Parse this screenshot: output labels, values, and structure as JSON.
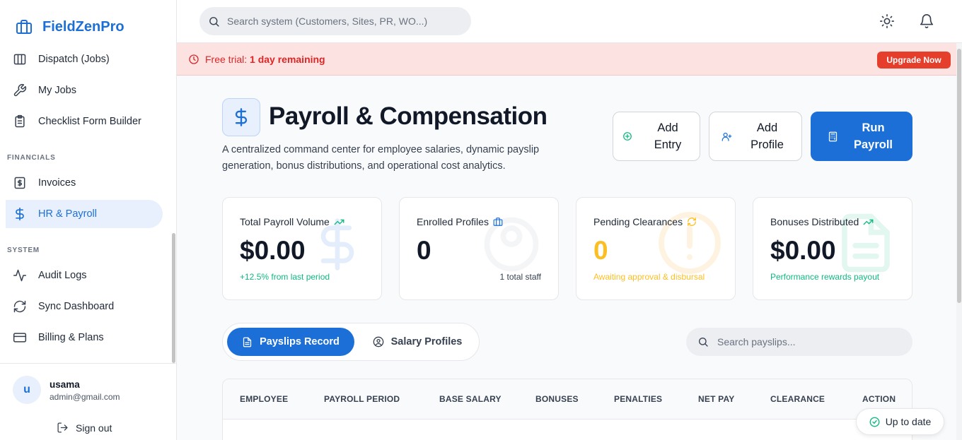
{
  "sidebar": {
    "brand": "FieldZenPro",
    "items": [
      {
        "label": "Dispatch (Jobs)",
        "icon": "columns-icon"
      },
      {
        "label": "My Jobs",
        "icon": "wrench-icon"
      },
      {
        "label": "Checklist Form Builder",
        "icon": "clipboard-icon"
      }
    ],
    "financials_label": "FINANCIALS",
    "financial_items": [
      {
        "label": "Invoices",
        "icon": "dollar-square-icon"
      },
      {
        "label": "HR & Payroll",
        "icon": "dollar-icon",
        "active": true
      }
    ],
    "system_label": "SYSTEM",
    "system_items": [
      {
        "label": "Audit Logs",
        "icon": "activity-icon"
      },
      {
        "label": "Sync Dashboard",
        "icon": "refresh-icon"
      },
      {
        "label": "Billing & Plans",
        "icon": "credit-card-icon"
      }
    ],
    "user": {
      "initial": "u",
      "name": "usama",
      "email": "admin@gmail.com"
    },
    "signout_label": "Sign out"
  },
  "topbar": {
    "search_placeholder": "Search system (Customers, Sites, PR, WO...)"
  },
  "trial": {
    "prefix": "Free trial: ",
    "remaining": "1 day remaining",
    "upgrade_label": "Upgrade Now"
  },
  "page": {
    "title": "Payroll & Compensation",
    "subtitle": "A centralized command center for employee salaries, dynamic payslip generation, bonus distributions, and operational cost analytics.",
    "buttons": {
      "add_entry": "Add Entry",
      "add_profile": "Add Profile",
      "run_payroll": "Run Payroll"
    }
  },
  "cards": [
    {
      "title": "Total Payroll Volume",
      "value": "$0.00",
      "note": "+12.5% from last period",
      "note_color": "#10b981"
    },
    {
      "title": "Enrolled Profiles",
      "value": "0",
      "note": "1 total staff",
      "note_color": "#374151"
    },
    {
      "title": "Pending Clearances",
      "value": "0",
      "note": "Awaiting approval & disbursal",
      "note_color": "#fbbf24"
    },
    {
      "title": "Bonuses Distributed",
      "value": "$0.00",
      "note": "Performance rewards payout",
      "note_color": "#10b981"
    }
  ],
  "tabs": {
    "payslips": "Payslips Record",
    "profiles": "Salary Profiles"
  },
  "table_search_placeholder": "Search payslips...",
  "table": {
    "headers": [
      "EMPLOYEE",
      "PAYROLL PERIOD",
      "BASE SALARY",
      "BONUSES",
      "PENALTIES",
      "NET PAY",
      "CLEARANCE",
      "ACTION"
    ]
  },
  "status": {
    "label": "Up to date"
  },
  "colors": {
    "accent": "#1d6fd8",
    "danger": "#e53e2b",
    "success": "#10b981",
    "warning": "#fbbf24"
  }
}
